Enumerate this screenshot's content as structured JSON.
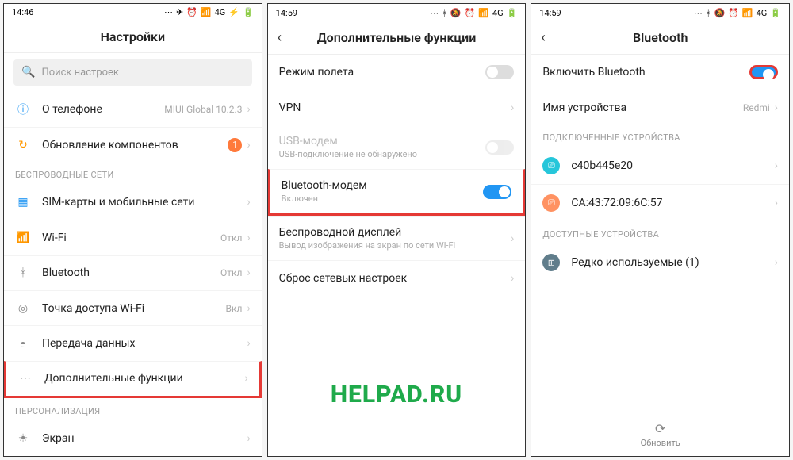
{
  "watermark": "HELPAD.RU",
  "screen1": {
    "time": "14:46",
    "status_4g": "4G",
    "title": "Настройки",
    "search_placeholder": "Поиск настроек",
    "about_label": "О телефоне",
    "about_value": "MIUI Global 10.2.3",
    "update_label": "Обновление компонентов",
    "update_badge": "1",
    "section_wireless": "БЕСПРОВОДНЫЕ СЕТИ",
    "sim_label": "SIM-карты и мобильные сети",
    "wifi_label": "Wi-Fi",
    "wifi_value": "Откл",
    "bt_label": "Bluetooth",
    "bt_value": "Откл",
    "hotspot_label": "Точка доступа Wi-Fi",
    "hotspot_value": "Вкл",
    "data_label": "Передача данных",
    "more_label": "Дополнительные функции",
    "section_personal": "ПЕРСОНАЛИЗАЦИЯ",
    "display_label": "Экран"
  },
  "screen2": {
    "time": "14:59",
    "status_4g": "4G",
    "title": "Дополнительные функции",
    "airplane_label": "Режим полета",
    "vpn_label": "VPN",
    "usb_label": "USB-модем",
    "usb_sub": "USB-подключение не обнаружено",
    "bt_modem_label": "Bluetooth-модем",
    "bt_modem_sub": "Включен",
    "wdisplay_label": "Беспроводной дисплей",
    "wdisplay_sub": "Вывод изображения на экран по сети Wi-Fi",
    "reset_label": "Сброс сетевых настроек"
  },
  "screen3": {
    "time": "14:59",
    "status_4g": "4G",
    "title": "Bluetooth",
    "enable_label": "Включить Bluetooth",
    "devname_label": "Имя устройства",
    "devname_value": "Redmi",
    "section_connected": "ПОДКЛЮЧЕННЫЕ УСТРОЙСТВА",
    "dev1": "c40b445e20",
    "dev2": "CA:43:72:09:6C:57",
    "section_available": "ДОСТУПНЫЕ УСТРОЙСТВА",
    "rare_label": "Редко используемые (1)",
    "refresh_label": "Обновить"
  }
}
